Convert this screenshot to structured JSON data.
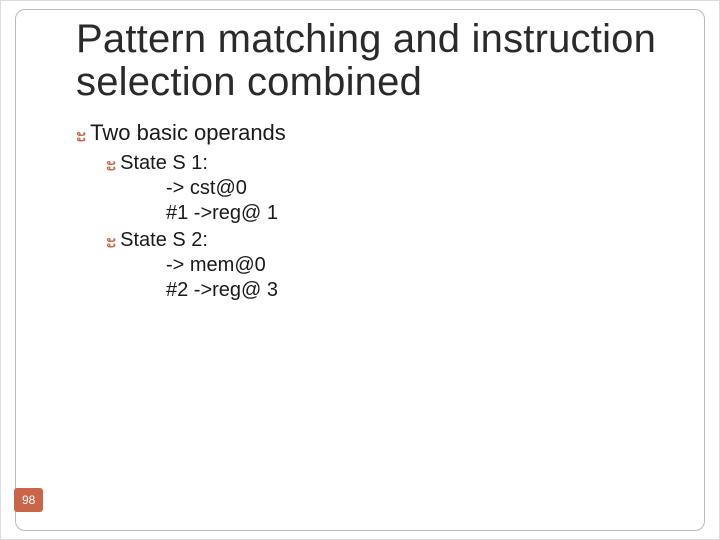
{
  "page_number": "98",
  "title": "Pattern matching and instruction selection combined",
  "bullets": {
    "lvl1": {
      "text": "Two basic operands"
    },
    "states": [
      {
        "heading": "State S 1:",
        "lines": [
          "-> cst@0",
          "#1 ->reg@ 1"
        ]
      },
      {
        "heading": "State S 2:",
        "lines": [
          "-> mem@0",
          "#2 ->reg@ 3"
        ]
      }
    ]
  },
  "bullet_glyph": "ະ"
}
